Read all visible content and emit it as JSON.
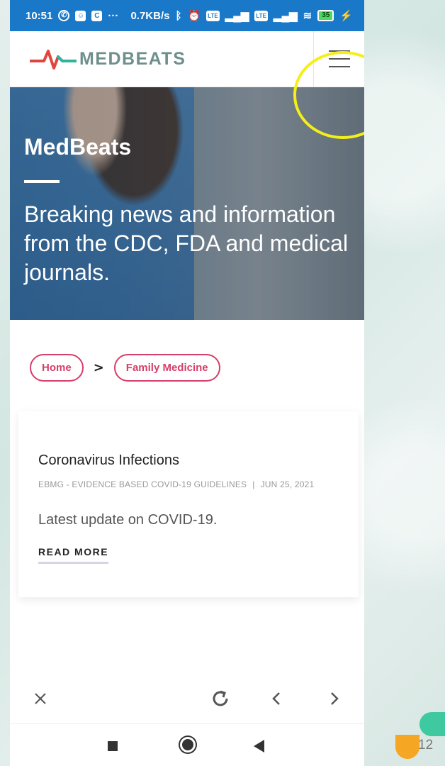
{
  "status_bar": {
    "time": "10:51",
    "more": "···",
    "network_speed": "0.7KB/s",
    "battery": "35",
    "lte_label": "LTE"
  },
  "header": {
    "brand": "MEDBEATS"
  },
  "hero": {
    "title": "MedBeats",
    "subtitle": "Breaking news and information from the CDC, FDA and medical journals."
  },
  "breadcrumb": {
    "items": [
      "Home",
      "Family Medicine"
    ]
  },
  "article": {
    "title": "Coronavirus Infections",
    "source": "EBMG - EVIDENCE BASED COVID-19 GUIDELINES",
    "date": "JUN 25, 2021",
    "excerpt": "Latest update on COVID-19.",
    "read_more": "READ MORE"
  },
  "slide": {
    "page_number": "12"
  },
  "colors": {
    "status_bar": "#1a78c9",
    "accent_pink": "#d63e6b",
    "brand_text": "#6e8f8c",
    "highlight": "#f4ef1a"
  }
}
